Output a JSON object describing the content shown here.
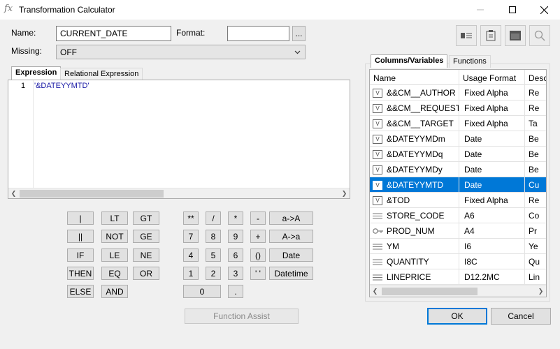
{
  "window": {
    "title": "Transformation Calculator",
    "icon": "fx-icon"
  },
  "form": {
    "name_label": "Name:",
    "name_value": "CURRENT_DATE",
    "format_label": "Format:",
    "format_value": "",
    "format_button": "...",
    "missing_label": "Missing:",
    "missing_value": "OFF"
  },
  "editor": {
    "tabs": [
      "Expression",
      "Relational Expression"
    ],
    "active_tab": "Expression",
    "line_number": "1",
    "code": "'&DATEYYMTD'"
  },
  "keypad": {
    "logic": [
      "|",
      "LT",
      "GT",
      "||",
      "NOT",
      "GE",
      "IF",
      "LE",
      "NE",
      "THEN",
      "EQ",
      "OR",
      "ELSE",
      "AND"
    ],
    "math": [
      "**",
      "/",
      "*",
      "-",
      "7",
      "8",
      "9",
      "+",
      "4",
      "5",
      "6",
      "()",
      "1",
      "2",
      "3",
      "' '",
      "0",
      "."
    ],
    "actions": [
      "a->A",
      "A->a",
      "Date",
      "Datetime"
    ],
    "function_assist": "Function Assist"
  },
  "toolbar": {
    "icons": [
      "field-list-icon",
      "clipboard-icon",
      "window-icon",
      "search-icon"
    ]
  },
  "right_panel": {
    "tabs": [
      "Columns/Variables",
      "Functions"
    ],
    "active_tab": "Columns/Variables",
    "columns": [
      "Name",
      "Usage Format",
      "Descr"
    ],
    "rows": [
      {
        "icon": "variable-icon",
        "name": "&&CM__AUTHOR",
        "usage": "Fixed Alpha",
        "desc": "Re"
      },
      {
        "icon": "variable-icon",
        "name": "&&CM__REQUEST",
        "usage": "Fixed Alpha",
        "desc": "Re"
      },
      {
        "icon": "variable-icon",
        "name": "&&CM__TARGET",
        "usage": "Fixed Alpha",
        "desc": "Ta"
      },
      {
        "icon": "variable-icon",
        "name": "&DATEYYMDm",
        "usage": "Date",
        "desc": "Be"
      },
      {
        "icon": "variable-icon",
        "name": "&DATEYYMDq",
        "usage": "Date",
        "desc": "Be"
      },
      {
        "icon": "variable-icon",
        "name": "&DATEYYMDy",
        "usage": "Date",
        "desc": "Be"
      },
      {
        "icon": "variable-icon",
        "name": "&DATEYYMTD",
        "usage": "Date",
        "desc": "Cu",
        "selected": true
      },
      {
        "icon": "variable-icon",
        "name": "&TOD",
        "usage": "Fixed Alpha",
        "desc": "Re"
      },
      {
        "icon": "column-icon",
        "name": "STORE_CODE",
        "usage": "A6",
        "desc": "Co"
      },
      {
        "icon": "key-icon",
        "name": "PROD_NUM",
        "usage": "A4",
        "desc": "Pr"
      },
      {
        "icon": "column-icon",
        "name": "YM",
        "usage": "I6",
        "desc": "Ye"
      },
      {
        "icon": "column-icon",
        "name": "QUANTITY",
        "usage": "I8C",
        "desc": "Qu"
      },
      {
        "icon": "column-icon",
        "name": "LINEPRICE",
        "usage": "D12.2MC",
        "desc": "Lin"
      }
    ]
  },
  "footer": {
    "ok": "OK",
    "cancel": "Cancel"
  },
  "colors": {
    "selection": "#0078d7",
    "code_text": "#1a1aa6"
  }
}
